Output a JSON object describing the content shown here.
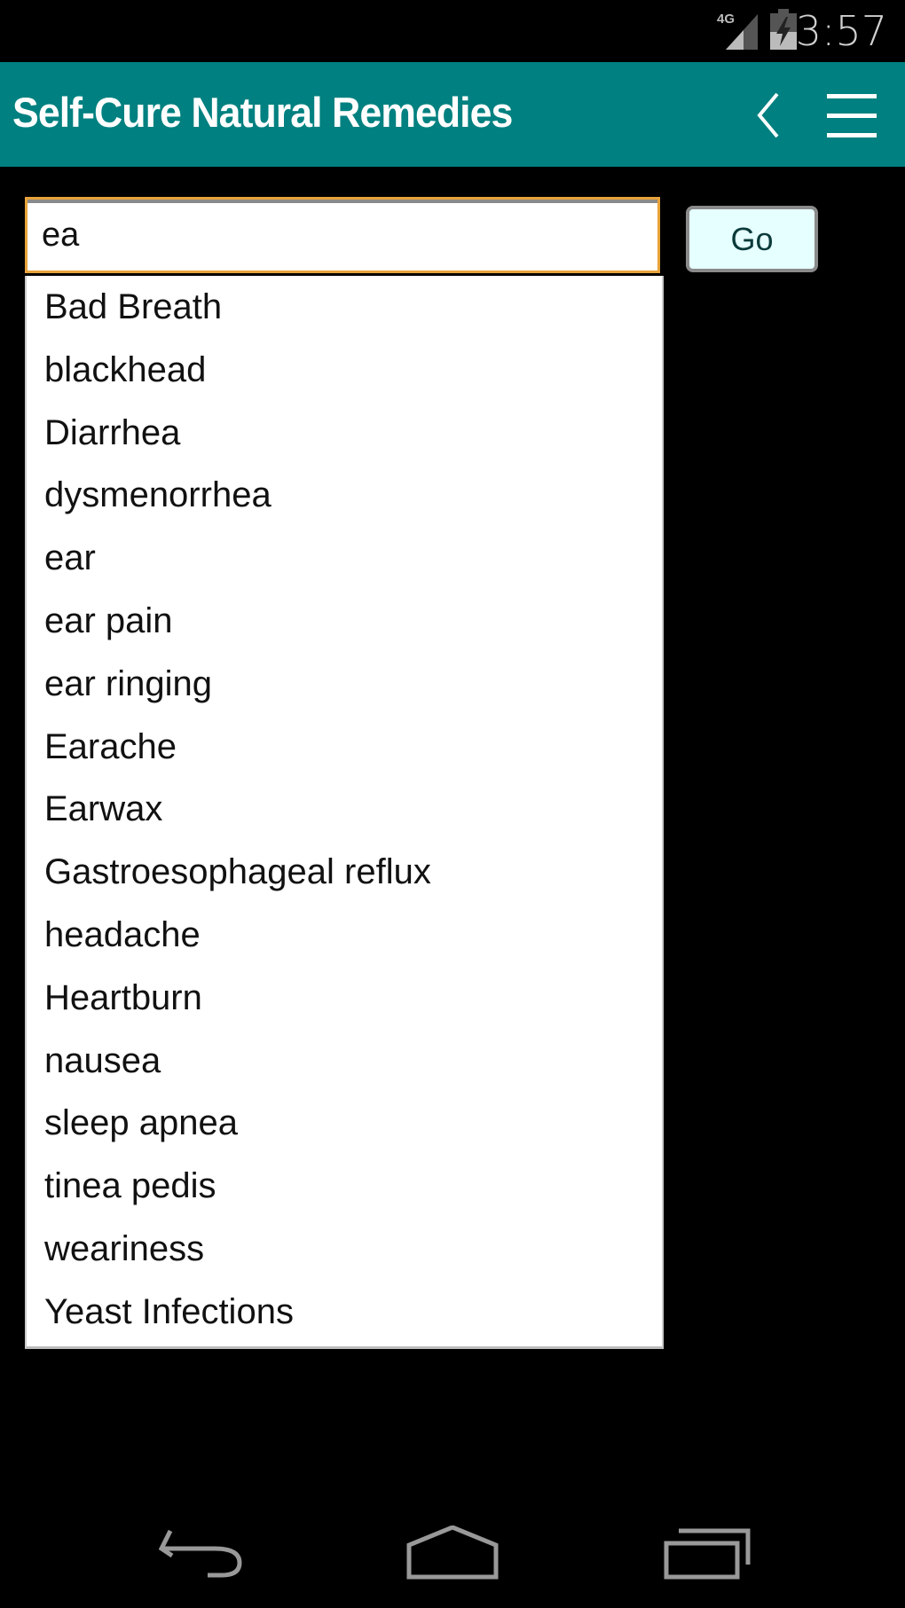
{
  "status_bar": {
    "network": "4G",
    "time": "3:57",
    "icons": [
      "signal-icon",
      "battery-charging-icon"
    ]
  },
  "app_bar": {
    "title": "Self-Cure Natural Remedies",
    "icons": [
      "back-chevron-icon",
      "menu-icon"
    ],
    "color": "#008080"
  },
  "search": {
    "value": "ea",
    "placeholder": "",
    "go_label": "Go"
  },
  "suggestions": [
    "Bad Breath",
    "blackhead",
    "Diarrhea",
    "dysmenorrhea",
    "ear",
    "ear pain",
    "ear ringing",
    "Earache",
    "Earwax",
    "Gastroesophageal reflux",
    "headache",
    "Heartburn",
    "nausea",
    "sleep apnea",
    "tinea pedis",
    "weariness",
    "Yeast Infections"
  ],
  "nav_bar": {
    "icons": [
      "back-icon",
      "home-icon",
      "recent-apps-icon"
    ]
  }
}
